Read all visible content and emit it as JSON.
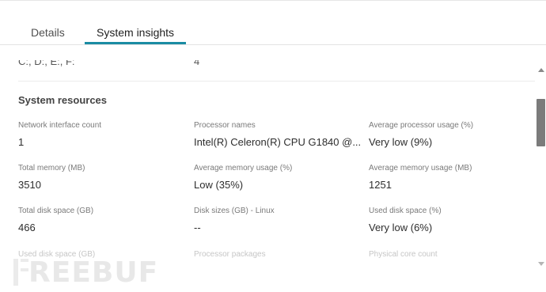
{
  "tabs": {
    "details": "Details",
    "system_insights": "System insights",
    "active": "system_insights"
  },
  "top_cut_row": {
    "left": "C:, D:, E:, F:",
    "right": "4"
  },
  "section": {
    "title": "System resources"
  },
  "fields": [
    {
      "label": "Network interface count",
      "value": "1"
    },
    {
      "label": "Processor names",
      "value": "Intel(R) Celeron(R) CPU G1840 @..."
    },
    {
      "label": "Average processor usage (%)",
      "value": "Very low (9%)"
    },
    {
      "label": "Total memory (MB)",
      "value": "3510"
    },
    {
      "label": "Average memory usage (%)",
      "value": "Low (35%)"
    },
    {
      "label": "Average memory usage (MB)",
      "value": "1251"
    },
    {
      "label": "Total disk space (GB)",
      "value": "466"
    },
    {
      "label": "Disk sizes (GB) - Linux",
      "value": "--"
    },
    {
      "label": "Used disk space (%)",
      "value": "Very low (6%)"
    },
    {
      "label": "Used disk space (GB)",
      "value": ""
    },
    {
      "label": "Processor packages",
      "value": ""
    },
    {
      "label": "Physical core count",
      "value": ""
    }
  ],
  "watermark": {
    "text": "REEBUF"
  },
  "colors": {
    "accent": "#1a8ca3",
    "scroll_thumb": "#7b7b7b"
  },
  "icons": {
    "scroll_up": "triangle-up",
    "scroll_down": "triangle-down"
  }
}
